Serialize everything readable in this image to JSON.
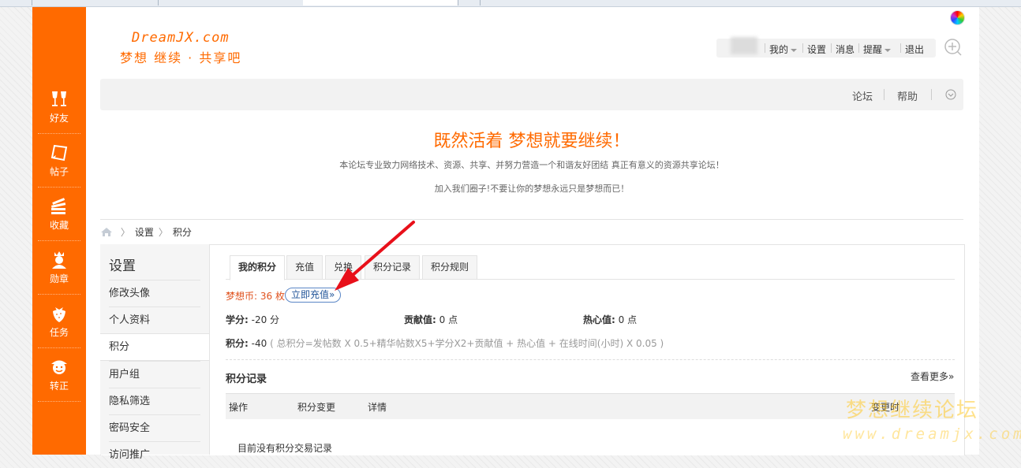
{
  "logo": {
    "line1": "DreamJX.com",
    "line2": "梦想 继续 · 共享吧"
  },
  "user_nav": [
    "我的",
    "设置",
    "消息",
    "提醒",
    "退出"
  ],
  "navbar": {
    "links": [
      "论坛",
      "帮助"
    ]
  },
  "slogan": {
    "headline": "既然活着 梦想就要继续！",
    "desc1": "本论坛专业致力网络技术、资源、共享、并努力营造一个和谐友好团结 真正有意义的资源共享论坛！",
    "desc2": "加入我们圈子!不要让你的梦想永远只是梦想而已！"
  },
  "left_bar": [
    "好友",
    "帖子",
    "收藏",
    "勋章",
    "任务",
    "转正"
  ],
  "breadcrumb": [
    "设置",
    "积分"
  ],
  "side_menu": {
    "title": "设置",
    "items": [
      "修改头像",
      "个人资料",
      "积分",
      "用户组",
      "隐私筛选",
      "密码安全",
      "访问推广"
    ],
    "active": "积分"
  },
  "tabs": [
    "我的积分",
    "充值",
    "兑换",
    "积分记录",
    "积分规则"
  ],
  "credits": {
    "coins_label": "梦想币: 36 枚",
    "recharge_label": "立即充值»",
    "xuefen_label": "学分:",
    "xuefen_value": "-20 分",
    "gongxian_label": "贡献值:",
    "gongxian_value": "0 点",
    "rexin_label": "热心值:",
    "rexin_value": "0 点",
    "total_label": "积分:",
    "total_value": "-40",
    "formula": "( 总积分=发帖数 X 0.5+精华帖数X5+学分X2+贡献值 + 热心值 + 在线时间(小时) X 0.05 )"
  },
  "records": {
    "title": "积分记录",
    "more": "查看更多»",
    "columns": [
      "操作",
      "积分变更",
      "详情",
      "变更时"
    ],
    "empty": "目前没有积分交易记录"
  },
  "watermark": {
    "line1": "梦想继续论坛",
    "line2": "www.dreamjx.com"
  },
  "colors": {
    "accent": "#ff6a00",
    "link_blue": "#225599",
    "coins_red": "#e0521e",
    "arrow_red": "#e8101a"
  },
  "icons": [
    "cheers-icon",
    "note-icon",
    "stack-icon",
    "medal-person-icon",
    "strawberry-icon",
    "clown-icon",
    "home-icon",
    "add-circle-icon",
    "color-wheel-icon"
  ]
}
